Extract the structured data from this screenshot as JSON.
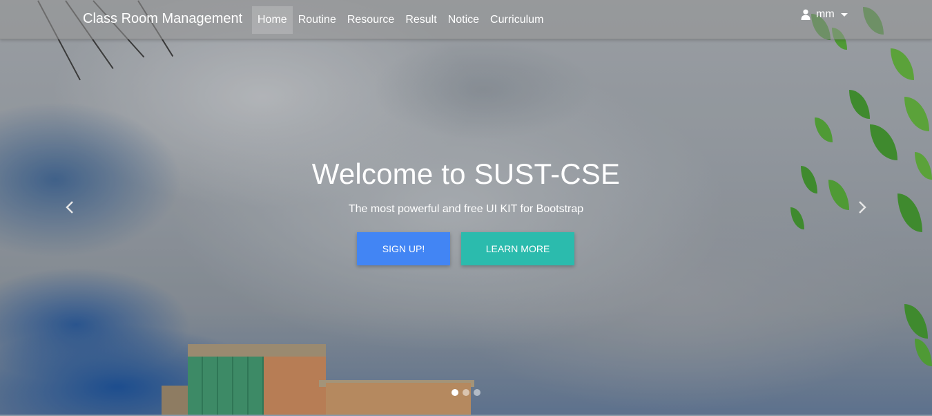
{
  "navbar": {
    "brand": "Class Room Management",
    "links": [
      {
        "label": "Home",
        "active": true
      },
      {
        "label": "Routine"
      },
      {
        "label": "Resource"
      },
      {
        "label": "Result"
      },
      {
        "label": "Notice"
      },
      {
        "label": "Curriculum"
      }
    ],
    "user": {
      "name": "mm",
      "icon": "user-icon"
    }
  },
  "carousel": {
    "headline": "Welcome to SUST-CSE",
    "subhead": "The most powerful and free UI KIT for Bootstrap",
    "buttons": {
      "signup": "SIGN UP!",
      "learn_more": "LEARN MORE"
    },
    "slide_count": 3,
    "active_slide": 1
  },
  "colors": {
    "primary_button": "#4285f4",
    "secondary_button": "#2bbbad"
  }
}
